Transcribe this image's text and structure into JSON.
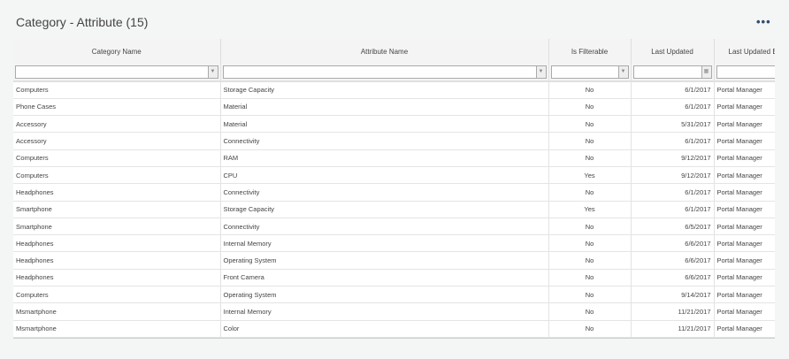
{
  "header": {
    "title": "Category - Attribute (15)",
    "more_icon": "ellipsis-icon"
  },
  "columns": [
    "Category Name",
    "Attribute Name",
    "Is Filterable",
    "Last Updated",
    "Last Updated By"
  ],
  "rows": [
    [
      "Computers",
      "Storage Capacity",
      "No",
      "6/1/2017",
      "Portal Manager"
    ],
    [
      "Phone Cases",
      "Material",
      "No",
      "6/1/2017",
      "Portal Manager"
    ],
    [
      "Accessory",
      "Material",
      "No",
      "5/31/2017",
      "Portal Manager"
    ],
    [
      "Accessory",
      "Connectivity",
      "No",
      "6/1/2017",
      "Portal Manager"
    ],
    [
      "Computers",
      "RAM",
      "No",
      "9/12/2017",
      "Portal Manager"
    ],
    [
      "Computers",
      "CPU",
      "Yes",
      "9/12/2017",
      "Portal Manager"
    ],
    [
      "Headphones",
      "Connectivity",
      "No",
      "6/1/2017",
      "Portal Manager"
    ],
    [
      "Smartphone",
      "Storage Capacity",
      "Yes",
      "6/1/2017",
      "Portal Manager"
    ],
    [
      "Smartphone",
      "Connectivity",
      "No",
      "6/5/2017",
      "Portal Manager"
    ],
    [
      "Headphones",
      "Internal Memory",
      "No",
      "6/6/2017",
      "Portal Manager"
    ],
    [
      "Headphones",
      "Operating System",
      "No",
      "6/6/2017",
      "Portal Manager"
    ],
    [
      "Headphones",
      "Front Camera",
      "No",
      "6/6/2017",
      "Portal Manager"
    ],
    [
      "Computers",
      "Operating System",
      "No",
      "9/14/2017",
      "Portal Manager"
    ],
    [
      "Msmartphone",
      "Internal Memory",
      "No",
      "11/21/2017",
      "Portal Manager"
    ],
    [
      "Msmartphone",
      "Color",
      "No",
      "11/21/2017",
      "Portal Manager"
    ]
  ]
}
